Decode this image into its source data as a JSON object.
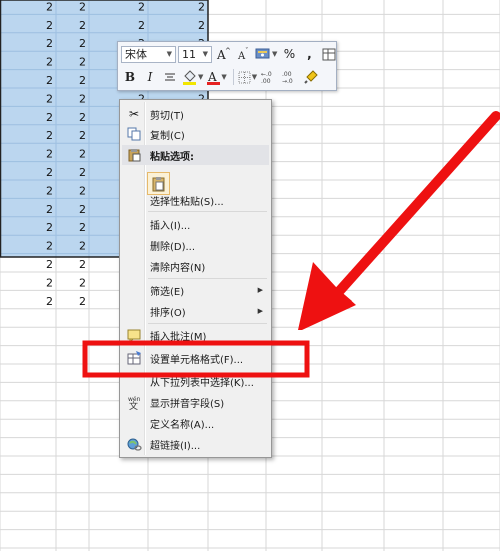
{
  "grid": {
    "cell_value": "2",
    "columns": 4,
    "rows": 17
  },
  "mini_toolbar": {
    "font_name": "宋体",
    "font_size": "11",
    "bold": "B",
    "italic": "I",
    "percent": "%",
    "comma": ","
  },
  "context_menu": {
    "items": [
      {
        "label": "剪切(T)",
        "icon": "scissors-icon"
      },
      {
        "label": "复制(C)",
        "icon": "copy-icon"
      },
      {
        "label": "粘贴选项:",
        "icon": "paste-icon"
      },
      {
        "label": "选择性粘贴(S)..."
      },
      {
        "label": "插入(I)..."
      },
      {
        "label": "删除(D)..."
      },
      {
        "label": "清除内容(N)"
      },
      {
        "label": "筛选(E)"
      },
      {
        "label": "排序(O)"
      },
      {
        "label": "插入批注(M)",
        "icon": "comment-icon"
      },
      {
        "label": "设置单元格格式(F)...",
        "icon": "format-cells-icon"
      },
      {
        "label": "从下拉列表中选择(K)..."
      },
      {
        "label": "显示拼音字段(S)",
        "icon": "phonetic-icon"
      },
      {
        "label": "定义名称(A)..."
      },
      {
        "label": "超链接(I)...",
        "icon": "hyperlink-icon"
      }
    ]
  },
  "colors": {
    "selection_fill": "#b7d4ee",
    "gridline": "#d7d7d7",
    "highlight_box": "#ee1111",
    "arrow": "#ee1111"
  }
}
